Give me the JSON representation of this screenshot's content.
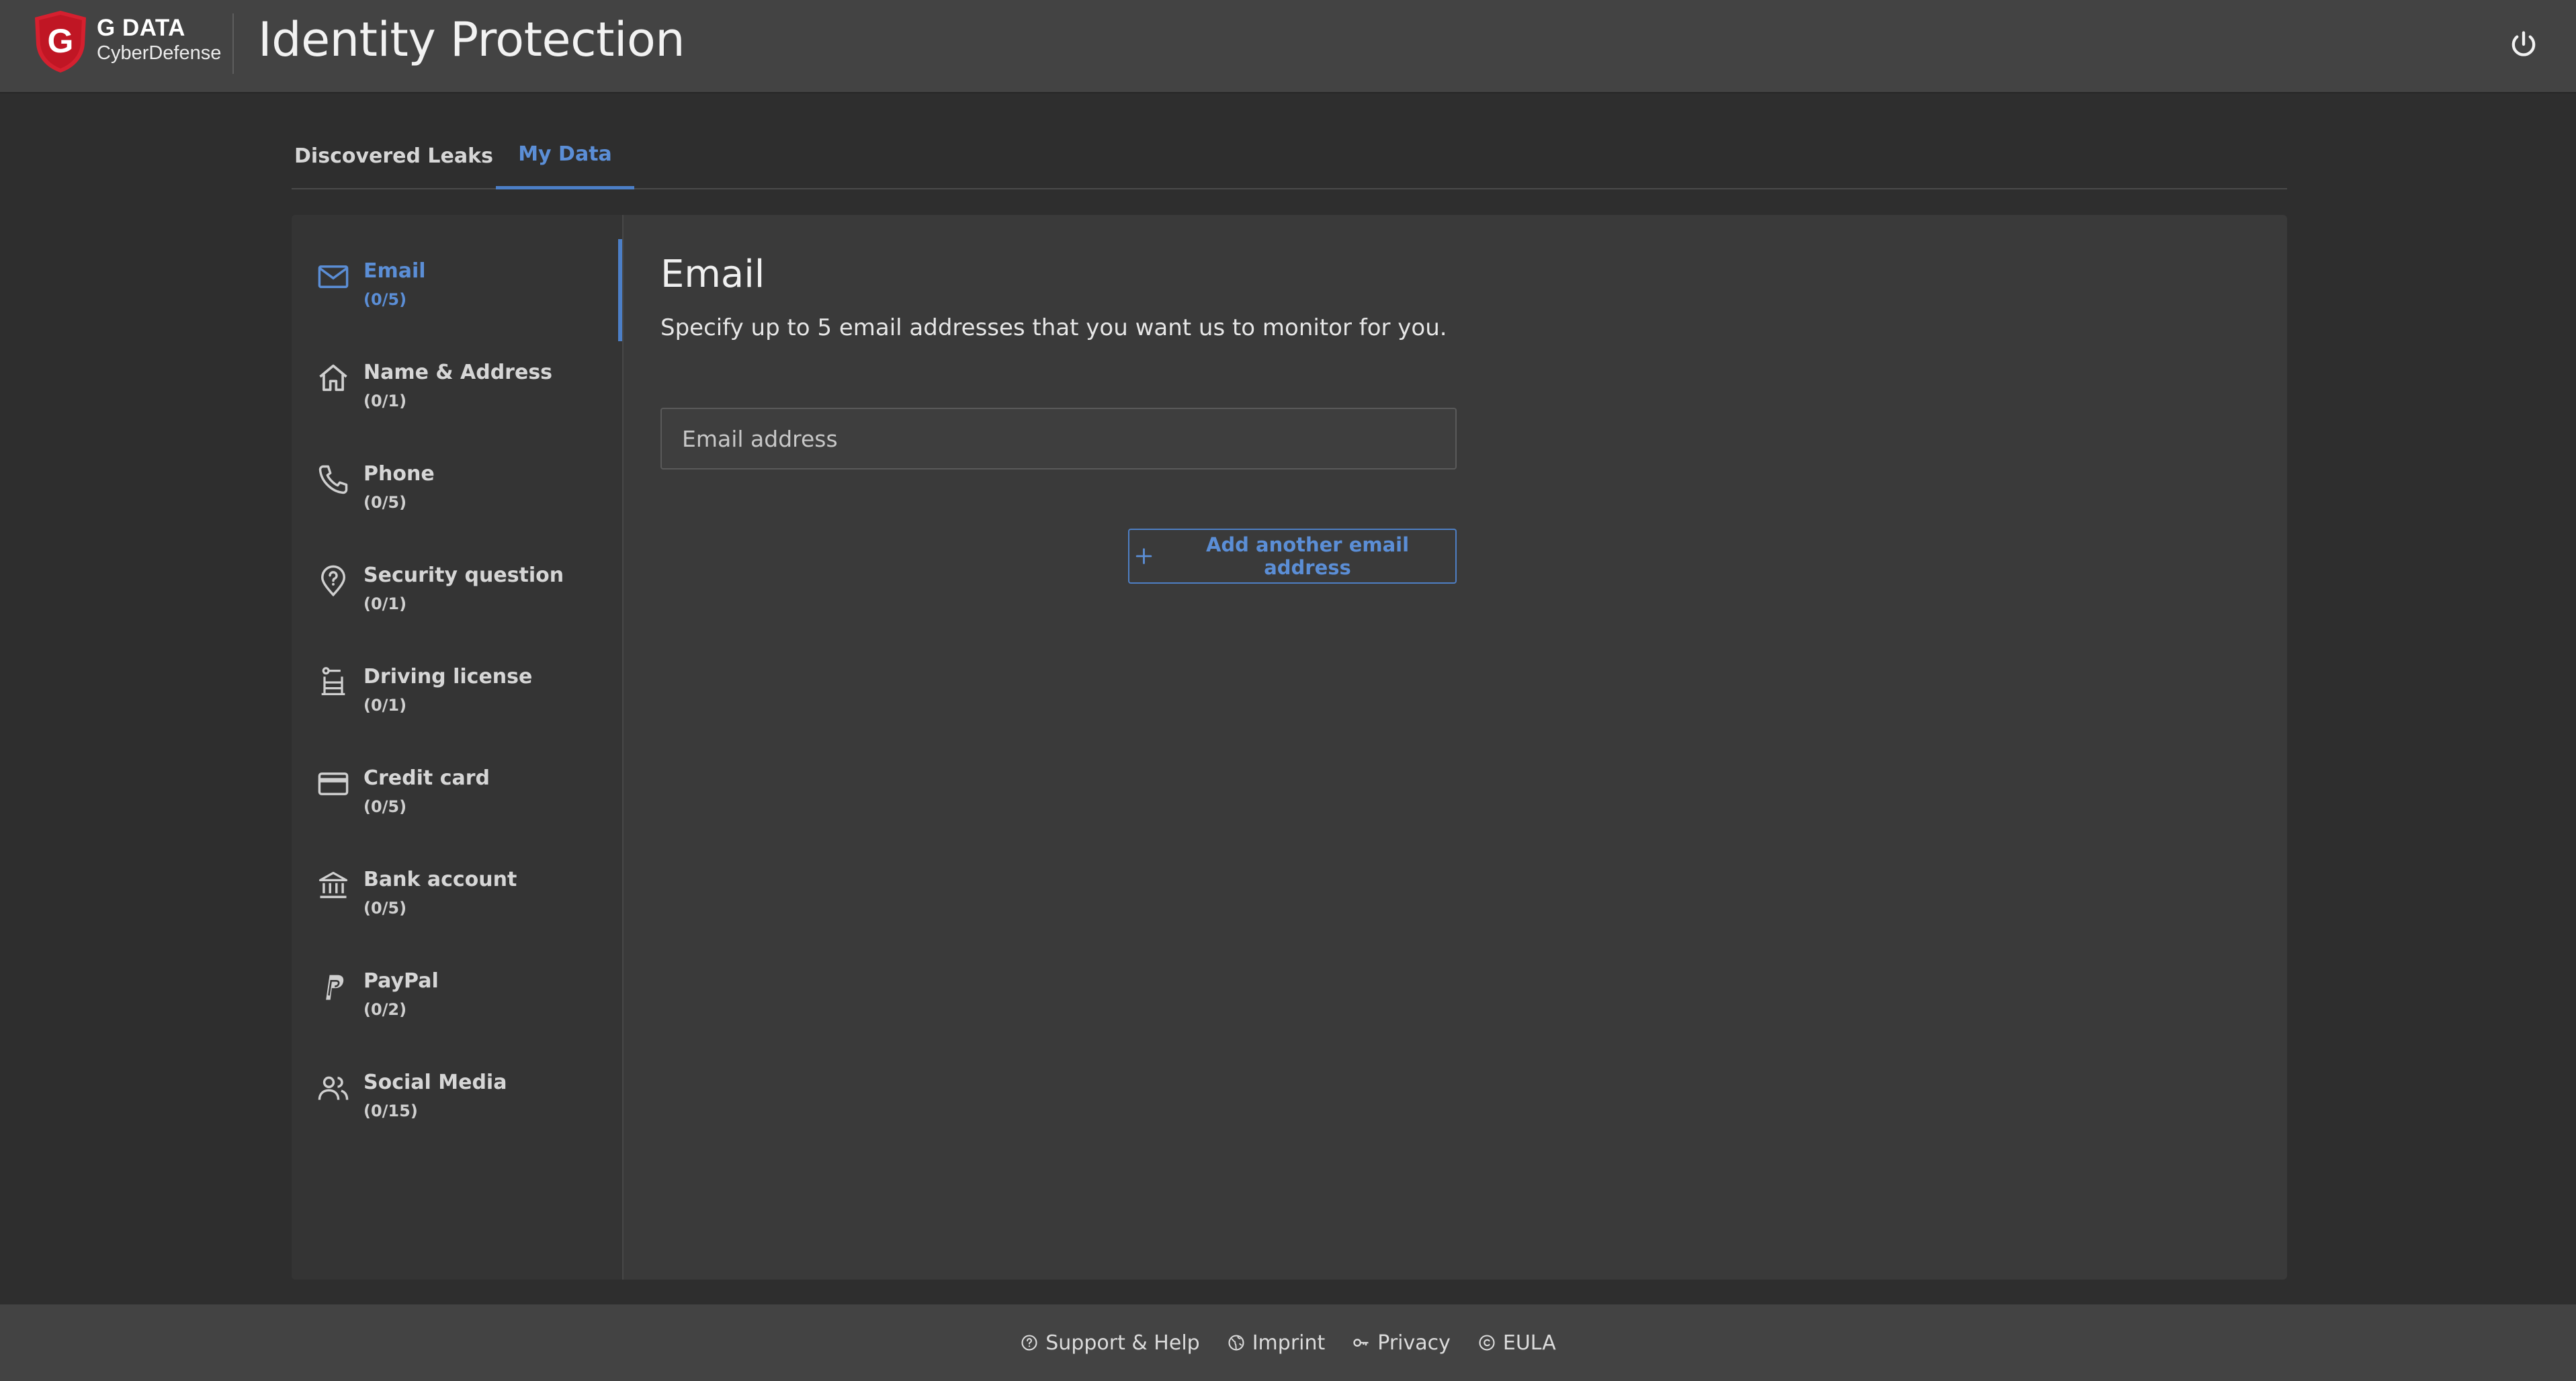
{
  "brand": {
    "name_line1": "G DATA",
    "name_line2": "CyberDefense",
    "logo_letter": "G",
    "accent": "#d5202f"
  },
  "header": {
    "title": "Identity Protection",
    "power_icon": "power-icon"
  },
  "tabs": [
    {
      "label": "Discovered Leaks",
      "active": false
    },
    {
      "label": "My Data",
      "active": true
    }
  ],
  "sidebar": {
    "items": [
      {
        "label": "Email",
        "count": "(0/5)",
        "icon": "mail-icon",
        "active": true
      },
      {
        "label": "Name & Address",
        "count": "(0/1)",
        "icon": "home-icon",
        "active": false
      },
      {
        "label": "Phone",
        "count": "(0/5)",
        "icon": "phone-icon",
        "active": false
      },
      {
        "label": "Security question",
        "count": "(0/1)",
        "icon": "location-question-icon",
        "active": false
      },
      {
        "label": "Driving license",
        "count": "(0/1)",
        "icon": "car-seat-icon",
        "active": false
      },
      {
        "label": "Credit card",
        "count": "(0/5)",
        "icon": "credit-card-icon",
        "active": false
      },
      {
        "label": "Bank account",
        "count": "(0/5)",
        "icon": "bank-icon",
        "active": false
      },
      {
        "label": "PayPal",
        "count": "(0/2)",
        "icon": "paypal-icon",
        "active": false
      },
      {
        "label": "Social Media",
        "count": "(0/15)",
        "icon": "people-icon",
        "active": false
      }
    ]
  },
  "main": {
    "title": "Email",
    "description": "Specify up to 5 email addresses that you want us to monitor for you.",
    "email_placeholder": "Email address",
    "email_value": "",
    "add_button_label": "Add another email address"
  },
  "footer": {
    "links": [
      {
        "label": "Support & Help",
        "icon": "help-circle-icon"
      },
      {
        "label": "Imprint",
        "icon": "globe-icon"
      },
      {
        "label": "Privacy",
        "icon": "key-icon"
      },
      {
        "label": "EULA",
        "icon": "copyright-icon"
      }
    ]
  },
  "colors": {
    "header_bg": "#434343",
    "page_bg": "#2e2e2e",
    "card_bg": "#3a3a3a",
    "accent_blue": "#5b8ed6"
  }
}
